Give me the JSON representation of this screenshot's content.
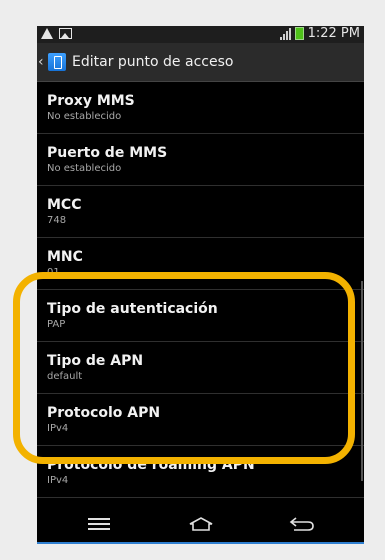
{
  "status_bar": {
    "time": "1:22 PM",
    "left_icons": [
      "warning-icon",
      "image-icon"
    ],
    "right_icons": [
      "signal-icon",
      "battery-icon"
    ],
    "colors": {
      "battery": "#4fc21a"
    }
  },
  "title_bar": {
    "title": "Editar punto de acceso",
    "icon": "sim-settings-icon"
  },
  "settings": [
    {
      "title": "Proxy MMS",
      "value": "No establecido"
    },
    {
      "title": "Puerto de MMS",
      "value": "No establecido"
    },
    {
      "title": "MCC",
      "value": "748"
    },
    {
      "title": "MNC",
      "value": "01"
    },
    {
      "title": "Tipo de autenticación",
      "value": "PAP"
    },
    {
      "title": "Tipo de APN",
      "value": "default"
    },
    {
      "title": "Protocolo APN",
      "value": "IPv4"
    },
    {
      "title": "Protocolo de roaming APN",
      "value": "IPv4"
    }
  ],
  "nav_bar": {
    "buttons": [
      "menu-icon",
      "home-icon",
      "back-icon"
    ]
  },
  "highlight": {
    "color": "#f3b200"
  }
}
